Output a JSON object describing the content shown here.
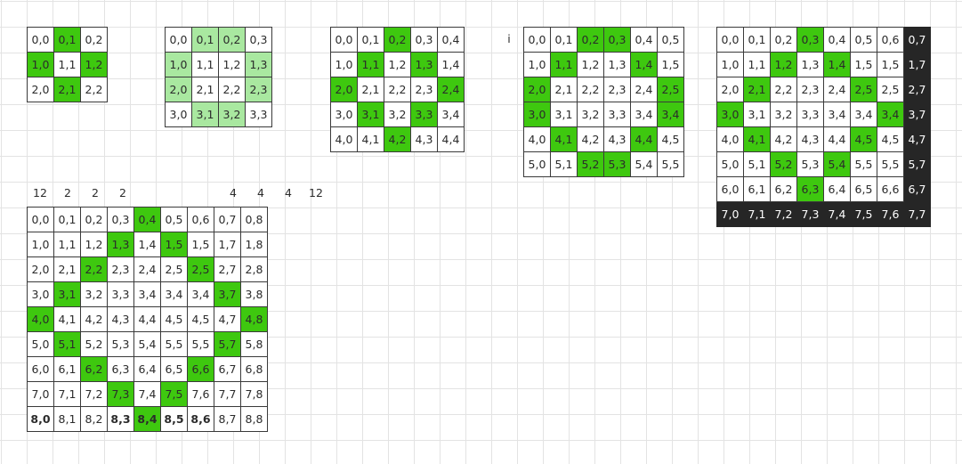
{
  "colors": {
    "highlight": "#3ec80f",
    "light_highlight": "#a9e8a0",
    "dark": "#262626",
    "grid_line": "#e3e3e3"
  },
  "grids": [
    {
      "name": "grid-3x3",
      "rows": [
        [
          {
            "t": "0,0"
          },
          {
            "t": "0,1",
            "s": "g"
          },
          {
            "t": "0,2"
          }
        ],
        [
          {
            "t": "1,0",
            "s": "g"
          },
          {
            "t": "1,1"
          },
          {
            "t": "1,2",
            "s": "g"
          }
        ],
        [
          {
            "t": "2,0"
          },
          {
            "t": "2,1",
            "s": "g"
          },
          {
            "t": "2,2"
          }
        ]
      ]
    },
    {
      "name": "grid-4x4",
      "rows": [
        [
          {
            "t": "0,0"
          },
          {
            "t": "0,1",
            "s": "lg"
          },
          {
            "t": "0,2",
            "s": "lg"
          },
          {
            "t": "0,3"
          }
        ],
        [
          {
            "t": "1,0",
            "s": "lg"
          },
          {
            "t": "1,1"
          },
          {
            "t": "1,2"
          },
          {
            "t": "1,3",
            "s": "lg"
          }
        ],
        [
          {
            "t": "2,0",
            "s": "lg"
          },
          {
            "t": "2,1"
          },
          {
            "t": "2,2"
          },
          {
            "t": "2,3",
            "s": "lg"
          }
        ],
        [
          {
            "t": "3,0"
          },
          {
            "t": "3,1",
            "s": "lg"
          },
          {
            "t": "3,2",
            "s": "lg"
          },
          {
            "t": "3,3"
          }
        ]
      ]
    },
    {
      "name": "grid-5x5",
      "rows": [
        [
          {
            "t": "0,0"
          },
          {
            "t": "0,1"
          },
          {
            "t": "0,2",
            "s": "g"
          },
          {
            "t": "0,3"
          },
          {
            "t": "0,4"
          }
        ],
        [
          {
            "t": "1,0"
          },
          {
            "t": "1,1",
            "s": "g"
          },
          {
            "t": "1,2"
          },
          {
            "t": "1,3",
            "s": "g"
          },
          {
            "t": "1,4"
          }
        ],
        [
          {
            "t": "2,0",
            "s": "g"
          },
          {
            "t": "2,1"
          },
          {
            "t": "2,2"
          },
          {
            "t": "2,3"
          },
          {
            "t": "2,4",
            "s": "g"
          }
        ],
        [
          {
            "t": "3,0"
          },
          {
            "t": "3,1",
            "s": "g"
          },
          {
            "t": "3,2"
          },
          {
            "t": "3,3",
            "s": "g"
          },
          {
            "t": "3,4"
          }
        ],
        [
          {
            "t": "4,0"
          },
          {
            "t": "4,1"
          },
          {
            "t": "4,2",
            "s": "g"
          },
          {
            "t": "4,3"
          },
          {
            "t": "4,4"
          }
        ]
      ]
    },
    {
      "name": "grid-6x6",
      "rows": [
        [
          {
            "t": "0,0"
          },
          {
            "t": "0,1"
          },
          {
            "t": "0,2",
            "s": "g"
          },
          {
            "t": "0,3",
            "s": "g"
          },
          {
            "t": "0,4"
          },
          {
            "t": "0,5"
          }
        ],
        [
          {
            "t": "1,0"
          },
          {
            "t": "1,1",
            "s": "g"
          },
          {
            "t": "1,2"
          },
          {
            "t": "1,3"
          },
          {
            "t": "1,4",
            "s": "g"
          },
          {
            "t": "1,5"
          }
        ],
        [
          {
            "t": "2,0",
            "s": "g"
          },
          {
            "t": "2,1"
          },
          {
            "t": "2,2"
          },
          {
            "t": "2,3"
          },
          {
            "t": "2,4"
          },
          {
            "t": "2,5",
            "s": "g"
          }
        ],
        [
          {
            "t": "3,0",
            "s": "g"
          },
          {
            "t": "3,1"
          },
          {
            "t": "3,2"
          },
          {
            "t": "3,3"
          },
          {
            "t": "3,4"
          },
          {
            "t": "3,4",
            "s": "g"
          }
        ],
        [
          {
            "t": "4,0"
          },
          {
            "t": "4,1",
            "s": "g"
          },
          {
            "t": "4,2"
          },
          {
            "t": "4,3"
          },
          {
            "t": "4,4",
            "s": "g"
          },
          {
            "t": "4,5"
          }
        ],
        [
          {
            "t": "5,0"
          },
          {
            "t": "5,1"
          },
          {
            "t": "5,2",
            "s": "g"
          },
          {
            "t": "5,3",
            "s": "g"
          },
          {
            "t": "5,4"
          },
          {
            "t": "5,5"
          }
        ]
      ]
    },
    {
      "name": "grid-8x8",
      "rows": [
        [
          {
            "t": "0,0"
          },
          {
            "t": "0,1"
          },
          {
            "t": "0,2"
          },
          {
            "t": "0,3",
            "s": "g"
          },
          {
            "t": "0,4"
          },
          {
            "t": "0,5"
          },
          {
            "t": "0,6"
          },
          {
            "t": "0,7",
            "s": "dk"
          }
        ],
        [
          {
            "t": "1,0"
          },
          {
            "t": "1,1"
          },
          {
            "t": "1,2",
            "s": "g"
          },
          {
            "t": "1,3"
          },
          {
            "t": "1,4",
            "s": "g"
          },
          {
            "t": "1,5"
          },
          {
            "t": "1,5"
          },
          {
            "t": "1,7",
            "s": "dk"
          }
        ],
        [
          {
            "t": "2,0"
          },
          {
            "t": "2,1",
            "s": "g"
          },
          {
            "t": "2,2"
          },
          {
            "t": "2,3"
          },
          {
            "t": "2,4"
          },
          {
            "t": "2,5",
            "s": "g"
          },
          {
            "t": "2,5"
          },
          {
            "t": "2,7",
            "s": "dk"
          }
        ],
        [
          {
            "t": "3,0",
            "s": "g"
          },
          {
            "t": "3,1"
          },
          {
            "t": "3,2"
          },
          {
            "t": "3,3"
          },
          {
            "t": "3,4"
          },
          {
            "t": "3,4"
          },
          {
            "t": "3,4",
            "s": "g"
          },
          {
            "t": "3,7",
            "s": "dk"
          }
        ],
        [
          {
            "t": "4,0"
          },
          {
            "t": "4,1",
            "s": "g"
          },
          {
            "t": "4,2"
          },
          {
            "t": "4,3"
          },
          {
            "t": "4,4"
          },
          {
            "t": "4,5",
            "s": "g"
          },
          {
            "t": "4,5"
          },
          {
            "t": "4,7",
            "s": "dk"
          }
        ],
        [
          {
            "t": "5,0"
          },
          {
            "t": "5,1"
          },
          {
            "t": "5,2",
            "s": "g"
          },
          {
            "t": "5,3"
          },
          {
            "t": "5,4",
            "s": "g"
          },
          {
            "t": "5,5"
          },
          {
            "t": "5,5"
          },
          {
            "t": "5,7",
            "s": "dk"
          }
        ],
        [
          {
            "t": "6,0"
          },
          {
            "t": "6,1"
          },
          {
            "t": "6,2"
          },
          {
            "t": "6,3",
            "s": "g"
          },
          {
            "t": "6,4"
          },
          {
            "t": "6,5"
          },
          {
            "t": "6,6"
          },
          {
            "t": "6,7",
            "s": "dk"
          }
        ],
        [
          {
            "t": "7,0",
            "s": "dk"
          },
          {
            "t": "7,1",
            "s": "dk"
          },
          {
            "t": "7,2",
            "s": "dk"
          },
          {
            "t": "7,3",
            "s": "dk"
          },
          {
            "t": "7,4",
            "s": "dk"
          },
          {
            "t": "7,5",
            "s": "dk"
          },
          {
            "t": "7,6",
            "s": "dk"
          },
          {
            "t": "7,7",
            "s": "dk"
          }
        ]
      ]
    },
    {
      "name": "grid-9x9",
      "rows": [
        [
          {
            "t": "0,0"
          },
          {
            "t": "0,1"
          },
          {
            "t": "0,2"
          },
          {
            "t": "0,3"
          },
          {
            "t": "0,4",
            "s": "g"
          },
          {
            "t": "0,5"
          },
          {
            "t": "0,6"
          },
          {
            "t": "0,7"
          },
          {
            "t": "0,8"
          }
        ],
        [
          {
            "t": "1,0"
          },
          {
            "t": "1,1"
          },
          {
            "t": "1,2"
          },
          {
            "t": "1,3",
            "s": "g"
          },
          {
            "t": "1,4"
          },
          {
            "t": "1,5",
            "s": "g"
          },
          {
            "t": "1,5"
          },
          {
            "t": "1,7"
          },
          {
            "t": "1,8"
          }
        ],
        [
          {
            "t": "2,0"
          },
          {
            "t": "2,1"
          },
          {
            "t": "2,2",
            "s": "g"
          },
          {
            "t": "2,3"
          },
          {
            "t": "2,4"
          },
          {
            "t": "2,5"
          },
          {
            "t": "2,5",
            "s": "g"
          },
          {
            "t": "2,7"
          },
          {
            "t": "2,8"
          }
        ],
        [
          {
            "t": "3,0"
          },
          {
            "t": "3,1",
            "s": "g"
          },
          {
            "t": "3,2"
          },
          {
            "t": "3,3"
          },
          {
            "t": "3,4"
          },
          {
            "t": "3,4"
          },
          {
            "t": "3,4"
          },
          {
            "t": "3,7",
            "s": "g"
          },
          {
            "t": "3,8"
          }
        ],
        [
          {
            "t": "4,0",
            "s": "g"
          },
          {
            "t": "4,1"
          },
          {
            "t": "4,2"
          },
          {
            "t": "4,3"
          },
          {
            "t": "4,4"
          },
          {
            "t": "4,5"
          },
          {
            "t": "4,5"
          },
          {
            "t": "4,7"
          },
          {
            "t": "4,8",
            "s": "g"
          }
        ],
        [
          {
            "t": "5,0"
          },
          {
            "t": "5,1",
            "s": "g"
          },
          {
            "t": "5,2"
          },
          {
            "t": "5,3"
          },
          {
            "t": "5,4"
          },
          {
            "t": "5,5"
          },
          {
            "t": "5,5"
          },
          {
            "t": "5,7",
            "s": "g"
          },
          {
            "t": "5,8"
          }
        ],
        [
          {
            "t": "6,0"
          },
          {
            "t": "6,1"
          },
          {
            "t": "6,2",
            "s": "g"
          },
          {
            "t": "6,3"
          },
          {
            "t": "6,4"
          },
          {
            "t": "6,5"
          },
          {
            "t": "6,6",
            "s": "g"
          },
          {
            "t": "6,7"
          },
          {
            "t": "6,8"
          }
        ],
        [
          {
            "t": "7,0"
          },
          {
            "t": "7,1"
          },
          {
            "t": "7,2"
          },
          {
            "t": "7,3",
            "s": "g"
          },
          {
            "t": "7,4"
          },
          {
            "t": "7,5",
            "s": "g"
          },
          {
            "t": "7,6"
          },
          {
            "t": "7,7"
          },
          {
            "t": "7,8"
          }
        ],
        [
          {
            "t": "8,0",
            "s": "b"
          },
          {
            "t": "8,1"
          },
          {
            "t": "8,2"
          },
          {
            "t": "8,3",
            "s": "b"
          },
          {
            "t": "8,4",
            "s": "g b"
          },
          {
            "t": "8,5",
            "s": "b"
          },
          {
            "t": "8,6",
            "s": "b"
          },
          {
            "t": "8,7"
          },
          {
            "t": "8,8"
          }
        ]
      ]
    }
  ],
  "marker_i": "i",
  "column_counts": [
    {
      "t": "12",
      "col": 0
    },
    {
      "t": "2",
      "col": 1
    },
    {
      "t": "2",
      "col": 2
    },
    {
      "t": "2",
      "col": 3
    },
    {
      "t": "4",
      "col": 7
    },
    {
      "t": "4",
      "col": 8
    },
    {
      "t": "4",
      "col": 9
    },
    {
      "t": "12",
      "col": 10
    }
  ]
}
